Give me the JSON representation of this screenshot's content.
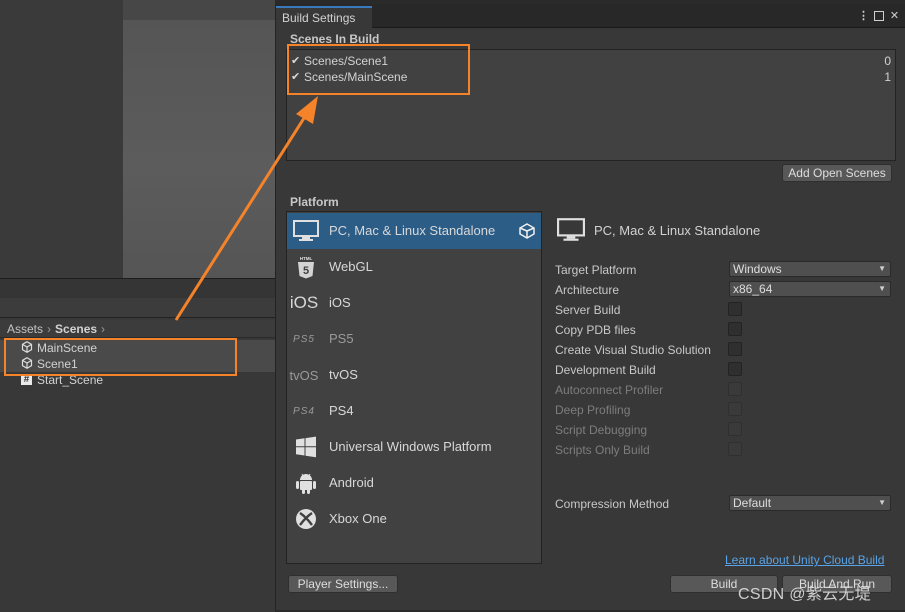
{
  "project": {
    "breadcrumb": {
      "root": "Assets",
      "current": "Scenes"
    },
    "assets": [
      {
        "name": "MainScene",
        "icon": "unity-scene-icon"
      },
      {
        "name": "Scene1",
        "icon": "unity-scene-icon"
      },
      {
        "name": "Start_Scene",
        "icon": "script-hash-icon"
      }
    ]
  },
  "window": {
    "title": "Build Settings",
    "scenes_header": "Scenes In Build",
    "scenes": [
      {
        "name": "Scenes/Scene1",
        "index": "0",
        "checked": true
      },
      {
        "name": "Scenes/MainScene",
        "index": "1",
        "checked": true
      }
    ],
    "add_open_scenes": "Add Open Scenes",
    "platform_header": "Platform",
    "platforms": [
      {
        "label": "PC, Mac & Linux Standalone",
        "icon": "monitor-icon",
        "selected": true
      },
      {
        "label": "WebGL",
        "icon": "html5-icon"
      },
      {
        "label": "iOS",
        "icon": "ios-icon"
      },
      {
        "label": "PS5",
        "icon": "ps5-icon"
      },
      {
        "label": "tvOS",
        "icon": "tvos-icon"
      },
      {
        "label": "PS4",
        "icon": "ps4-icon"
      },
      {
        "label": "Universal Windows Platform",
        "icon": "windows-icon"
      },
      {
        "label": "Android",
        "icon": "android-icon"
      },
      {
        "label": "Xbox One",
        "icon": "xbox-icon"
      }
    ],
    "details": {
      "title": "PC, Mac & Linux Standalone",
      "target_platform": {
        "label": "Target Platform",
        "value": "Windows"
      },
      "architecture": {
        "label": "Architecture",
        "value": "x86_64"
      },
      "options": [
        {
          "label": "Server Build",
          "enabled": true
        },
        {
          "label": "Copy PDB files",
          "enabled": true
        },
        {
          "label": "Create Visual Studio Solution",
          "enabled": true
        },
        {
          "label": "Development Build",
          "enabled": true
        },
        {
          "label": "Autoconnect Profiler",
          "enabled": false
        },
        {
          "label": "Deep Profiling",
          "enabled": false
        },
        {
          "label": "Script Debugging",
          "enabled": false
        },
        {
          "label": "Scripts Only Build",
          "enabled": false
        }
      ],
      "compression": {
        "label": "Compression Method",
        "value": "Default"
      }
    },
    "cloud_link": "Learn about Unity Cloud Build",
    "player_settings": "Player Settings...",
    "build": "Build",
    "build_and_run": "Build And Run"
  },
  "watermark": "CSDN @紫云无堤",
  "colors": {
    "highlight": "#f5832a",
    "selection": "#2c5d87",
    "link": "#59a3e6"
  }
}
